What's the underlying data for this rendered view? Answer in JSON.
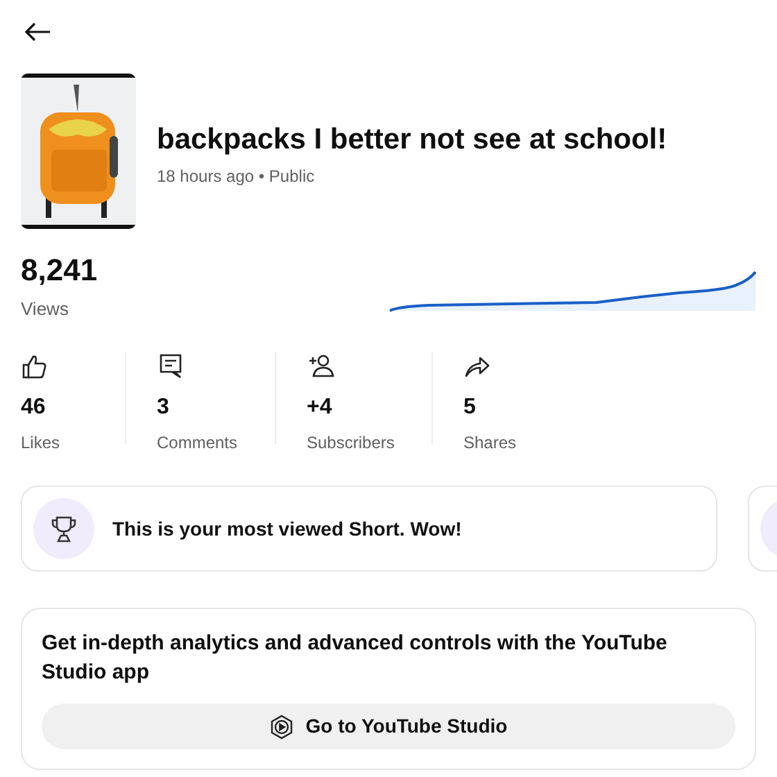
{
  "video": {
    "title": "backpacks I better not see at school!",
    "meta": "18 hours ago • Public"
  },
  "views": {
    "count": "8,241",
    "label": "Views"
  },
  "stats": [
    {
      "kind": "like",
      "value": "46",
      "label": "Likes"
    },
    {
      "kind": "comment",
      "value": "3",
      "label": "Comments"
    },
    {
      "kind": "subscriber",
      "value": "+4",
      "label": "Subscribers"
    },
    {
      "kind": "share",
      "value": "5",
      "label": "Shares"
    }
  ],
  "insight": {
    "text": "This is your most viewed Short. Wow!"
  },
  "studio_card": {
    "text": "Get in-depth analytics and advanced controls with the YouTube Studio app",
    "button": "Go to YouTube Studio"
  }
}
